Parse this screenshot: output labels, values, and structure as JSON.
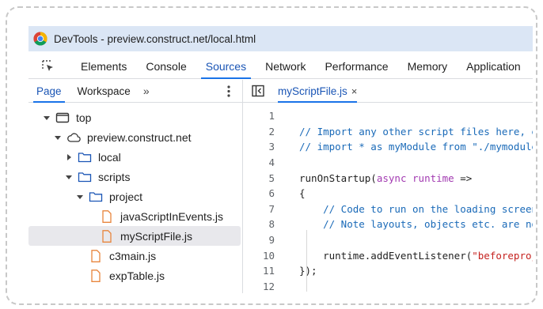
{
  "window": {
    "title": "DevTools - preview.construct.net/local.html"
  },
  "main_tabs": [
    "Elements",
    "Console",
    "Sources",
    "Network",
    "Performance",
    "Memory",
    "Application"
  ],
  "active_main_tab": "Sources",
  "navigator": {
    "tabs": [
      "Page",
      "Workspace"
    ],
    "more": "»",
    "tree": [
      {
        "label": "top",
        "level": 0,
        "expanded": true,
        "icon": "frame-icon"
      },
      {
        "label": "preview.construct.net",
        "level": 1,
        "expanded": true,
        "icon": "cloud-icon"
      },
      {
        "label": "local",
        "level": 2,
        "expanded": false,
        "icon": "folder-icon"
      },
      {
        "label": "scripts",
        "level": 2,
        "expanded": true,
        "icon": "folder-icon"
      },
      {
        "label": "project",
        "level": 3,
        "expanded": true,
        "icon": "folder-icon"
      },
      {
        "label": "javaScriptInEvents.js",
        "level": 4,
        "icon": "js-file-icon"
      },
      {
        "label": "myScriptFile.js",
        "level": 4,
        "icon": "js-file-icon",
        "selected": true
      },
      {
        "label": "c3main.js",
        "level": 3,
        "icon": "js-file-icon"
      },
      {
        "label": "expTable.js",
        "level": 3,
        "icon": "js-file-icon"
      }
    ]
  },
  "editor": {
    "open_file": "myScriptFile.js",
    "close_glyph": "×",
    "lines": [
      {
        "n": "1",
        "text": ""
      },
      {
        "n": "2",
        "text": "// Import any other script files here, e.g.:"
      },
      {
        "n": "3",
        "text": "// import * as myModule from \"./mymodule.js\";"
      },
      {
        "n": "4",
        "text": ""
      },
      {
        "n": "5",
        "text": "runOnStartup(async runtime =>"
      },
      {
        "n": "6",
        "text": "{"
      },
      {
        "n": "7",
        "text": "    // Code to run on the loading screen."
      },
      {
        "n": "8",
        "text": "    // Note layouts, objects etc. are not yet available."
      },
      {
        "n": "9",
        "text": ""
      },
      {
        "n": "10",
        "text": "    runtime.addEventListener(\"beforeprojectstart\""
      },
      {
        "n": "11",
        "text": "});"
      },
      {
        "n": "12",
        "text": ""
      }
    ]
  },
  "colors": {
    "accent": "#1a73e8",
    "titlebar": "#dbe6f5",
    "comment": "#1a6ab8",
    "keyword": "#a23ab1",
    "string": "#c5221f",
    "js_file_icon": "#e8853d"
  }
}
